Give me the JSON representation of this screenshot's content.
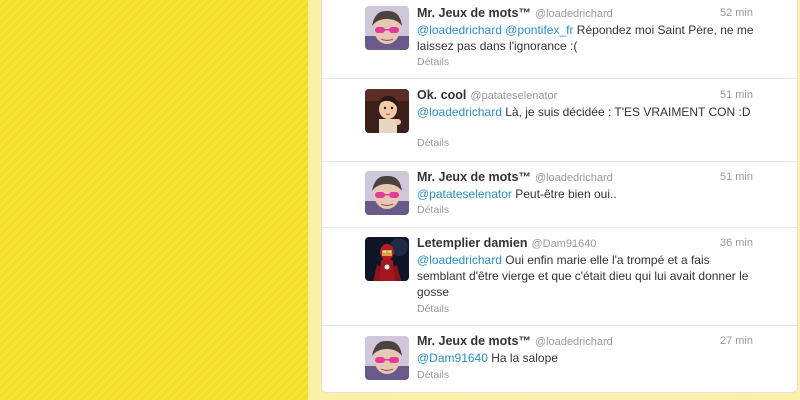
{
  "colors": {
    "background_yellow": "#f7e334",
    "mention_blue": "#2a8ebf"
  },
  "tweets": [
    {
      "name": "Mr. Jeux de mots™",
      "handle": "@loadedrichard",
      "time": "52 min",
      "mention1": "@loadedrichard",
      "mention2": "@pontifex_fr",
      "text": " Répondez moi Saint Père, ne me laissez pas dans l'ignorance :(",
      "details": "Détails",
      "avatar": "avatar-boy-pink-glasses"
    },
    {
      "name": "Ok. cool",
      "handle": "@patateselenator",
      "time": "51 min",
      "mention1": "@loadedrichard",
      "text": " Là, je suis décidée : T'ES VRAIMENT CON :D",
      "details": "Détails",
      "avatar": "avatar-girl-cartoon"
    },
    {
      "name": "Mr. Jeux de mots™",
      "handle": "@loadedrichard",
      "time": "51 min",
      "mention1": "@patateselenator",
      "text": " Peut-être bien oui..",
      "details": "Détails",
      "avatar": "avatar-boy-pink-glasses"
    },
    {
      "name": "Letemplier damien",
      "handle": "@Dam91640",
      "time": "36 min",
      "mention1": "@loadedrichard",
      "text": " Oui enfin marie elle l'a trompé et a fais semblant d'être vierge et que c'était dieu qui lui avait donner le gosse",
      "details": "Détails",
      "avatar": "avatar-iron-man"
    },
    {
      "name": "Mr. Jeux de mots™",
      "handle": "@loadedrichard",
      "time": "27 min",
      "mention1": "@Dam91640",
      "text": " Ha la salope",
      "details": "Détails",
      "avatar": "avatar-boy-pink-glasses"
    }
  ]
}
